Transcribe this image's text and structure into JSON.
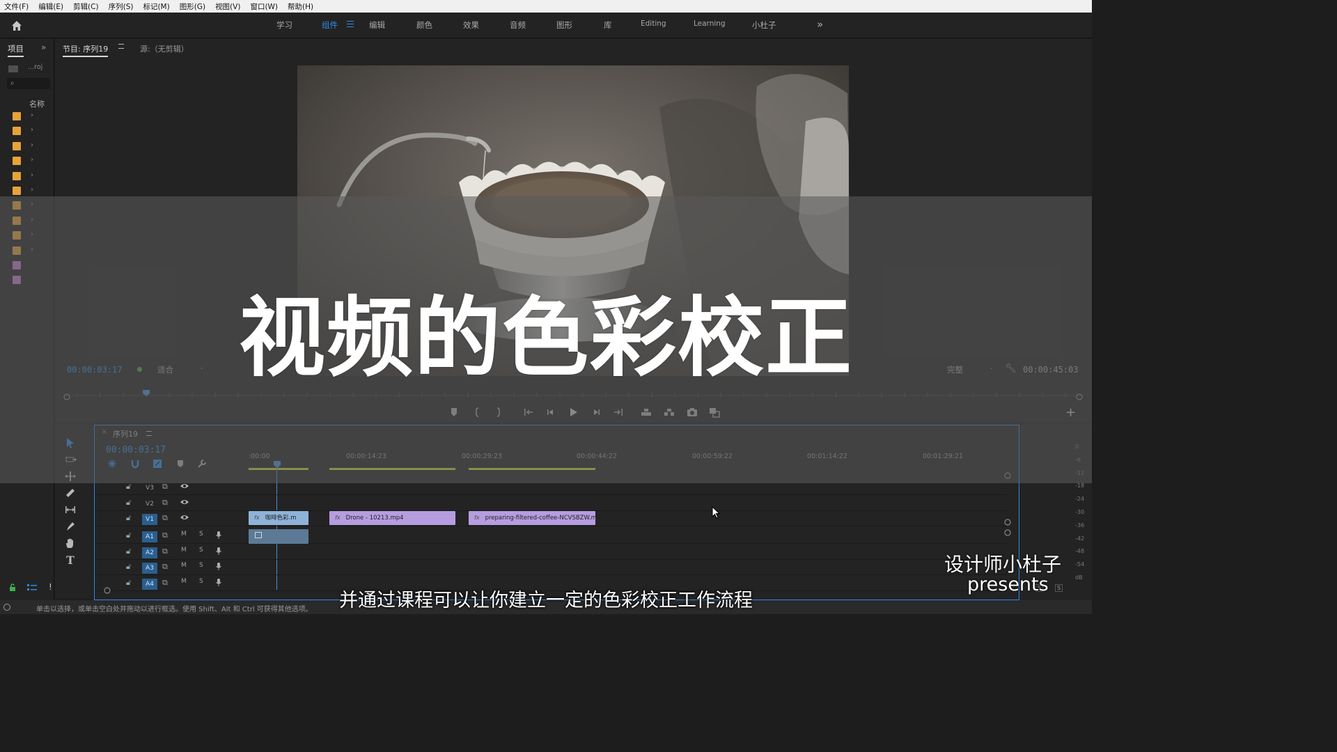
{
  "menu": [
    "文件(F)",
    "编辑(E)",
    "剪辑(C)",
    "序列(S)",
    "标记(M)",
    "图形(G)",
    "视图(V)",
    "窗口(W)",
    "帮助(H)"
  ],
  "workspaces": {
    "tabs": [
      "学习",
      "组件",
      "编辑",
      "颜色",
      "效果",
      "音频",
      "图形",
      "库",
      "Editing",
      "Learning",
      "小杜子"
    ],
    "active": "组件",
    "more": "»"
  },
  "project": {
    "tab": "项目",
    "more": "»",
    "name": "...roj",
    "column": "名称",
    "bins": [
      "#e8a23a",
      "#e8a23a",
      "#e8a23a",
      "#e8a23a",
      "#e8a23a",
      "#e8a23a",
      "#e8a23a",
      "#e8a23a",
      "#e8a23a",
      "#e8a23a",
      "#c77ad0",
      "#c77ad0"
    ]
  },
  "monitor": {
    "program_tab": "节目: 序列19",
    "source_tab": "源:（无剪辑）",
    "timecode": "00:00:03:17",
    "fit": "适合",
    "quality": "完整",
    "duration": "00:00:45:03"
  },
  "timeline": {
    "sequence_tab": "序列19",
    "timecode": "00:00:03:17",
    "ruler": [
      ":00:00",
      "00:00:14:23",
      "00:00:29:23",
      "00:00:44:22",
      "00:00:59:22",
      "00:01:14:22",
      "00:01:29:21"
    ],
    "video_tracks": [
      "V3",
      "V2",
      "V1"
    ],
    "audio_tracks": [
      "A1",
      "A2",
      "A3",
      "A4"
    ],
    "track_letters": {
      "m": "M",
      "s": "S"
    },
    "clips": [
      {
        "name": "咖啡色彩.m",
        "color": "#8fb3d8",
        "track": "V1"
      },
      {
        "name": "Drone - 10213.mp4",
        "color": "#b69de0",
        "track": "V1"
      },
      {
        "name": "preparing-filtered-coffee-NCVSBZW.mov",
        "color": "#b69de0",
        "track": "V1"
      }
    ],
    "fx_label": "fx"
  },
  "meter_labels": [
    "0",
    "-6",
    "-12",
    "-18",
    "-24",
    "-30",
    "-36",
    "-42",
    "-48",
    "-54",
    "dB"
  ],
  "meter_solo": "S",
  "status": "单击以选择，或单击空白处并拖动以进行框选。使用 Shift、Alt 和 Ctrl 可获得其他选项。",
  "overlay": {
    "title": "视频的色彩校正",
    "credit_line1": "设计师小杜子",
    "credit_line2": "presents",
    "subtitle": "并通过课程可以让你建立一定的色彩校正工作流程"
  }
}
